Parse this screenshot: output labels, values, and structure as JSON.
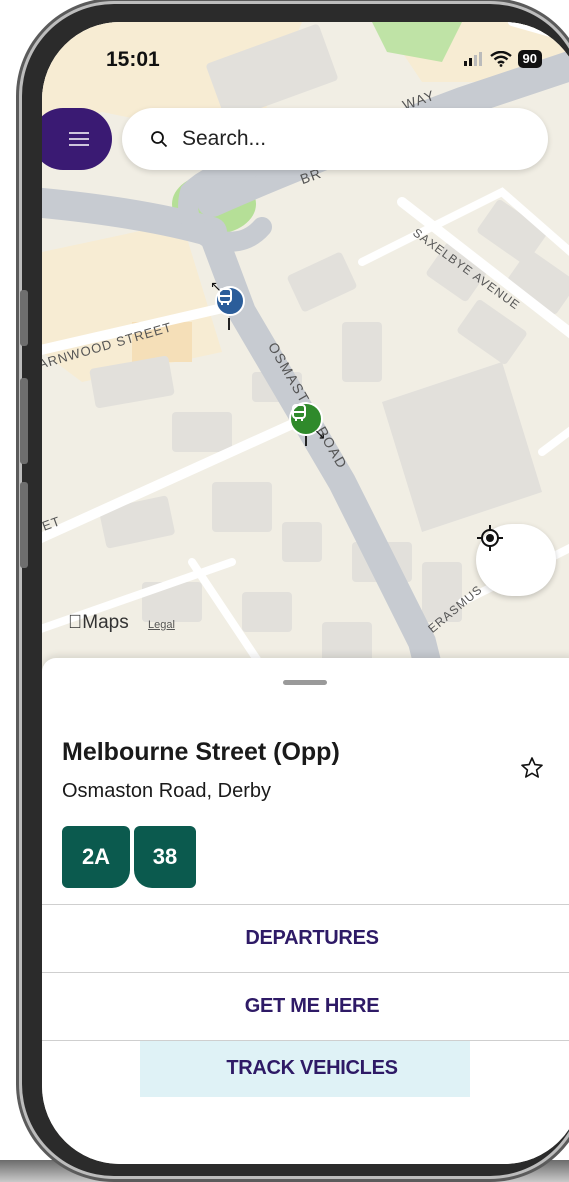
{
  "status_bar": {
    "time": "15:01",
    "battery": "90"
  },
  "search": {
    "placeholder": "Search..."
  },
  "map": {
    "labels": {
      "street1": "ARNWOOD STREET",
      "street2": "OSMASTON ROAD",
      "street3": "SAXELBYE AVENUE",
      "street4": "ERASMUS",
      "street5": "WAY",
      "street6": "BR",
      "street7": "ET"
    },
    "attribution": "Maps",
    "legal": "Legal"
  },
  "stop": {
    "name": "Melbourne Street (Opp)",
    "location": "Osmaston Road, Derby",
    "routes": [
      "2A",
      "38"
    ]
  },
  "actions": {
    "departures": "DEPARTURES",
    "get_me_here": "GET ME HERE",
    "track_vehicles": "TRACK VEHICLES"
  },
  "colors": {
    "brand_purple": "#3a1a73",
    "route_green": "#0b5a4e",
    "action_text": "#2e1a66",
    "track_highlight": "#dff2f6"
  }
}
